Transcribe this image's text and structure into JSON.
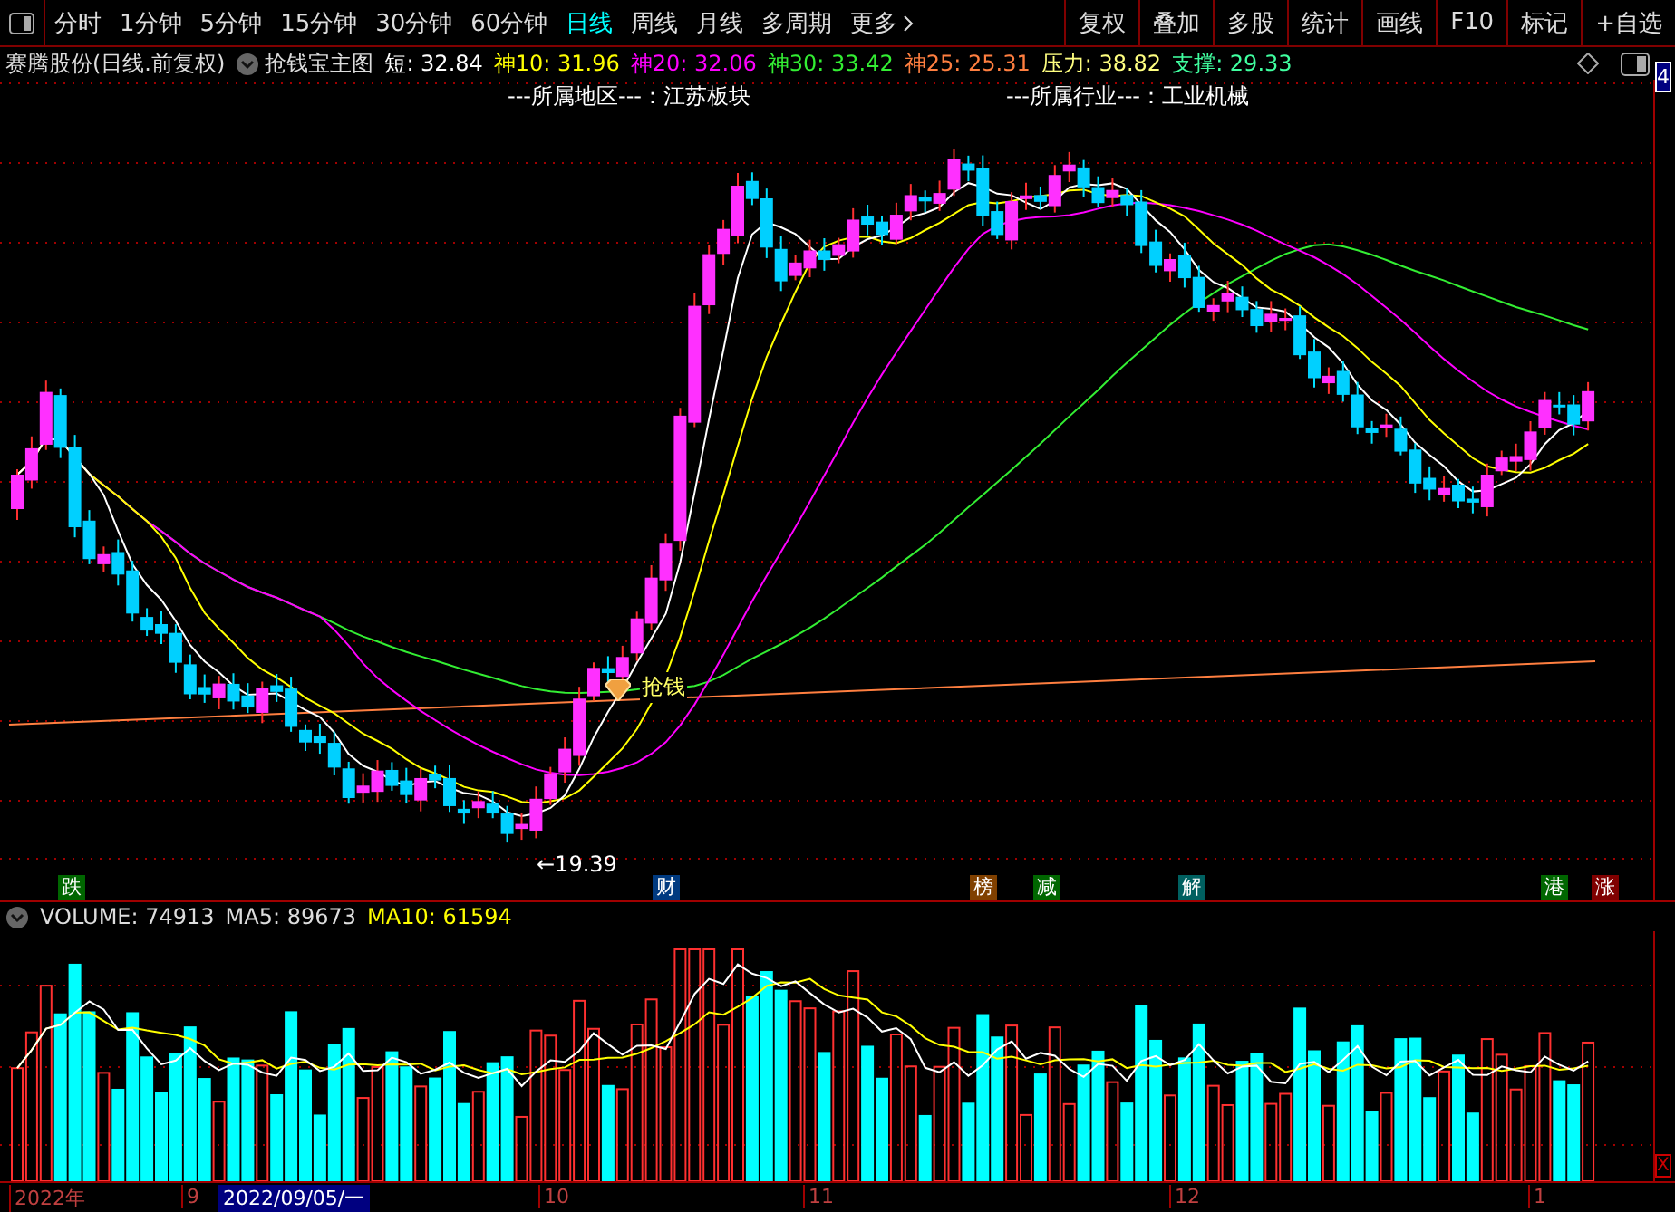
{
  "toolbar": {
    "periods": [
      {
        "label": "分时",
        "selected": false
      },
      {
        "label": "1分钟",
        "selected": false
      },
      {
        "label": "5分钟",
        "selected": false
      },
      {
        "label": "15分钟",
        "selected": false
      },
      {
        "label": "30分钟",
        "selected": false
      },
      {
        "label": "60分钟",
        "selected": false
      },
      {
        "label": "日线",
        "selected": true
      },
      {
        "label": "周线",
        "selected": false
      },
      {
        "label": "月线",
        "selected": false
      },
      {
        "label": "多周期",
        "selected": false
      },
      {
        "label": "更多",
        "selected": false
      }
    ],
    "buttons": [
      "复权",
      "叠加",
      "多股",
      "统计",
      "画线",
      "F10",
      "标记",
      "+自选"
    ]
  },
  "header": {
    "title": "赛腾股份(日线.前复权)",
    "indicator": "抢钱宝主图",
    "values": [
      {
        "text": "短: 32.84",
        "color": "#ffffff"
      },
      {
        "text": "神10: 31.96",
        "color": "#ffff00"
      },
      {
        "text": "神20: 32.06",
        "color": "#ff00ff"
      },
      {
        "text": "神30: 33.42",
        "color": "#33ee33"
      },
      {
        "text": "神25: 25.31",
        "color": "#ff7f40"
      },
      {
        "text": "压力: 38.82",
        "color": "#ffff80"
      },
      {
        "text": "支撑: 29.33",
        "color": "#40ffa0"
      }
    ]
  },
  "chart": {
    "region": "---所属地区---：江苏板块",
    "industry": "---所属行业---：工业机械",
    "signal": "抢钱",
    "low": "←19.39",
    "price_tag": "4",
    "events": [
      {
        "label": "跌",
        "color": "#006600"
      },
      {
        "label": "财",
        "color": "#003a80"
      },
      {
        "label": "榜",
        "color": "#804000"
      },
      {
        "label": "减",
        "color": "#006600"
      },
      {
        "label": "解",
        "color": "#006060"
      },
      {
        "label": "港",
        "color": "#006600"
      },
      {
        "label": "涨",
        "color": "#800000"
      }
    ]
  },
  "volume": {
    "label": "VOLUME: 74913",
    "ma5": "MA5: 89673",
    "ma10": "MA10: 61594",
    "close_mark": "X"
  },
  "date_axis": {
    "labels": [
      "2022年",
      "9",
      "10",
      "11",
      "12",
      "1"
    ],
    "cursor_date": "2022/09/05/一"
  }
}
